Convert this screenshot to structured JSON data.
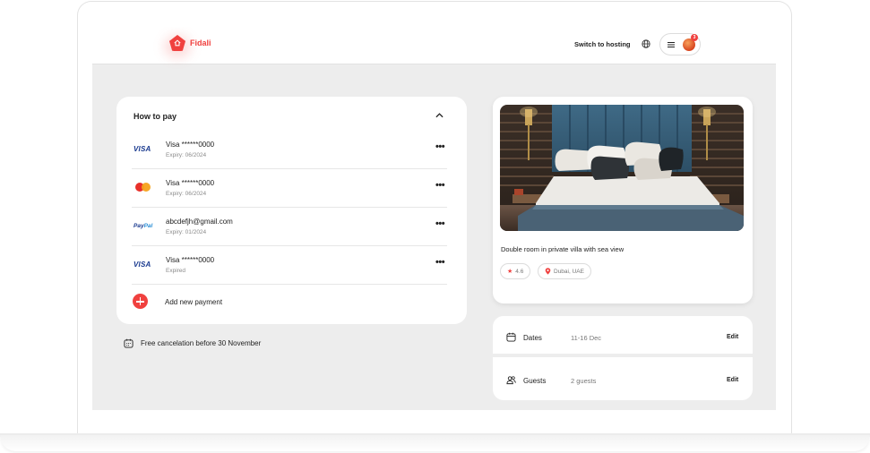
{
  "brand": {
    "name": "Fidali",
    "accent": "#f0413f"
  },
  "header": {
    "switch_hosting": "Switch to hosting",
    "notification_count": "3"
  },
  "payment": {
    "title": "How to pay",
    "methods": [
      {
        "brand": "VISA",
        "name": "Visa ******0000",
        "sub": "Expiry: 06/2024"
      },
      {
        "brand": "mastercard",
        "name": "Visa ******0000",
        "sub": "Expiry: 06/2024"
      },
      {
        "brand": "PayPal",
        "name": "abcdefjh@gmail.com",
        "sub": "Expiry: 01/2024"
      },
      {
        "brand": "VISA",
        "name": "Visa ******0000",
        "sub": "Expired"
      }
    ],
    "more_label": "•••",
    "add_label": "Add new payment"
  },
  "free_cancel": "Free cancelation before 30 November",
  "property": {
    "title": "Double room in private villa with sea view",
    "rating": "4.6",
    "location": "Dubai, UAE"
  },
  "booking": {
    "dates_label": "Dates",
    "dates_value": "11-16 Dec",
    "guests_label": "Guests",
    "guests_value": "2 guests",
    "edit_label": "Edit"
  }
}
